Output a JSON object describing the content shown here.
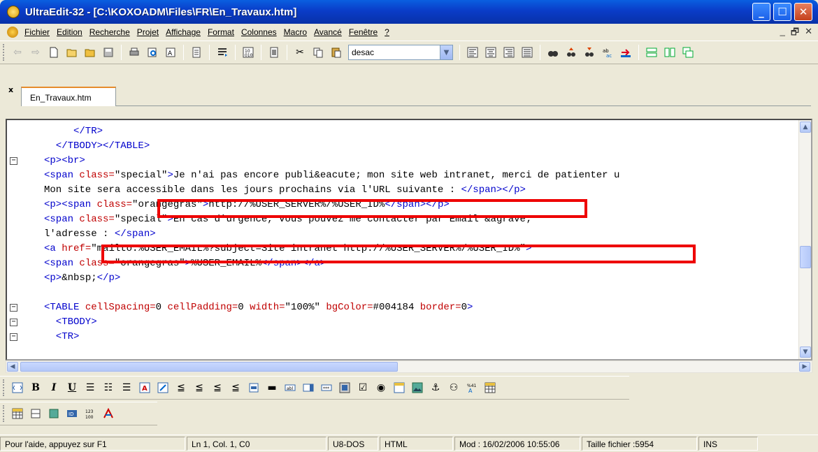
{
  "window": {
    "title": "UltraEdit-32 - [C:\\KOXOADM\\Files\\FR\\En_Travaux.htm]",
    "minimize": "_",
    "maximize": "☐",
    "close": "✕"
  },
  "menu": {
    "items": [
      "Fichier",
      "Edition",
      "Recherche",
      "Projet",
      "Affichage",
      "Format",
      "Colonnes",
      "Macro",
      "Avancé",
      "Fenêtre",
      "?"
    ],
    "mdi_min": "_",
    "mdi_restore": "🗗",
    "mdi_close": "✕"
  },
  "toolbar": {
    "combo_value": "desac",
    "combo_arrow": "▼"
  },
  "tabs": {
    "close": "x",
    "active": "En_Travaux.htm"
  },
  "code_lines": [
    {
      "fold": "",
      "segs": [
        [
          "t",
          "     </TR>"
        ]
      ]
    },
    {
      "fold": "",
      "segs": [
        [
          "t",
          "  </TBODY></TABLE>"
        ]
      ]
    },
    {
      "fold": "−",
      "segs": [
        [
          "t",
          "<p><br>"
        ]
      ]
    },
    {
      "fold": "",
      "segs": [
        [
          "t",
          "<span "
        ],
        [
          "a",
          "class="
        ],
        [
          "s",
          "\"special\""
        ],
        [
          "t",
          ">"
        ],
        [
          "x",
          "Je n'ai pas encore publi&eacute; mon site web intranet, merci de patienter u"
        ]
      ]
    },
    {
      "fold": "",
      "segs": [
        [
          "x",
          "Mon site sera accessible dans les jours prochains via l'URL suivante : "
        ],
        [
          "t",
          "</span></p>"
        ]
      ]
    },
    {
      "fold": "",
      "segs": [
        [
          "t",
          "<p><span "
        ],
        [
          "a",
          "class="
        ],
        [
          "s",
          "\"orangegras\""
        ],
        [
          "t",
          ">"
        ],
        [
          "x",
          "http://%USER_SERVER%/%USER_ID%"
        ],
        [
          "t",
          "</span></p>"
        ]
      ]
    },
    {
      "fold": "",
      "segs": [
        [
          "t",
          "<span "
        ],
        [
          "a",
          "class="
        ],
        [
          "s",
          "\"special\""
        ],
        [
          "t",
          ">"
        ],
        [
          "x",
          "En cas d'urgence, vous pouvez me contacter par Email &agrave;"
        ]
      ]
    },
    {
      "fold": "",
      "segs": [
        [
          "x",
          "l'adresse : "
        ],
        [
          "t",
          "</span>"
        ]
      ]
    },
    {
      "fold": "",
      "segs": [
        [
          "t",
          "<a "
        ],
        [
          "a",
          "href="
        ],
        [
          "s",
          "\"mailto:%USER_EMAIL%?subject=Site intranet http://%USER_SERVER%/%USER_ID%\""
        ],
        [
          "t",
          ">"
        ]
      ]
    },
    {
      "fold": "",
      "segs": [
        [
          "t",
          "<span "
        ],
        [
          "a",
          "class="
        ],
        [
          "s",
          "\"orangegras\""
        ],
        [
          "t",
          ">"
        ],
        [
          "x",
          "%USER_EMAIL%"
        ],
        [
          "t",
          "</span></a>"
        ]
      ]
    },
    {
      "fold": "",
      "segs": [
        [
          "t",
          "<p>"
        ],
        [
          "x",
          "&nbsp;"
        ],
        [
          "t",
          "</p>"
        ]
      ]
    },
    {
      "fold": "",
      "segs": [
        [
          "t",
          ""
        ]
      ]
    },
    {
      "fold": "−",
      "segs": [
        [
          "t",
          "<TABLE "
        ],
        [
          "a",
          "cellSpacing="
        ],
        [
          "s",
          "0 "
        ],
        [
          "a",
          "cellPadding="
        ],
        [
          "s",
          "0 "
        ],
        [
          "a",
          "width="
        ],
        [
          "s",
          "\"100%\" "
        ],
        [
          "a",
          "bgColor="
        ],
        [
          "s",
          "#004184 "
        ],
        [
          "a",
          "border="
        ],
        [
          "s",
          "0"
        ],
        [
          "t",
          ">"
        ]
      ]
    },
    {
      "fold": "−",
      "segs": [
        [
          "t",
          "  <TBODY>"
        ]
      ]
    },
    {
      "fold": "−",
      "segs": [
        [
          "t",
          "  <TR>"
        ]
      ]
    }
  ],
  "status": {
    "help": "Pour l'aide, appuyez sur F1",
    "position": "Ln 1, Col. 1, C0",
    "encoding": "U8-DOS",
    "mode": "HTML",
    "modified": "Mod : 16/02/2006 10:55:06",
    "filesize": "Taille fichier :5954",
    "insert": "INS"
  },
  "colors": {
    "tag": "#0000cc",
    "attribute": "#c00000",
    "highlight_box": "#ee0000",
    "titlebar": "#0a3cc8"
  }
}
